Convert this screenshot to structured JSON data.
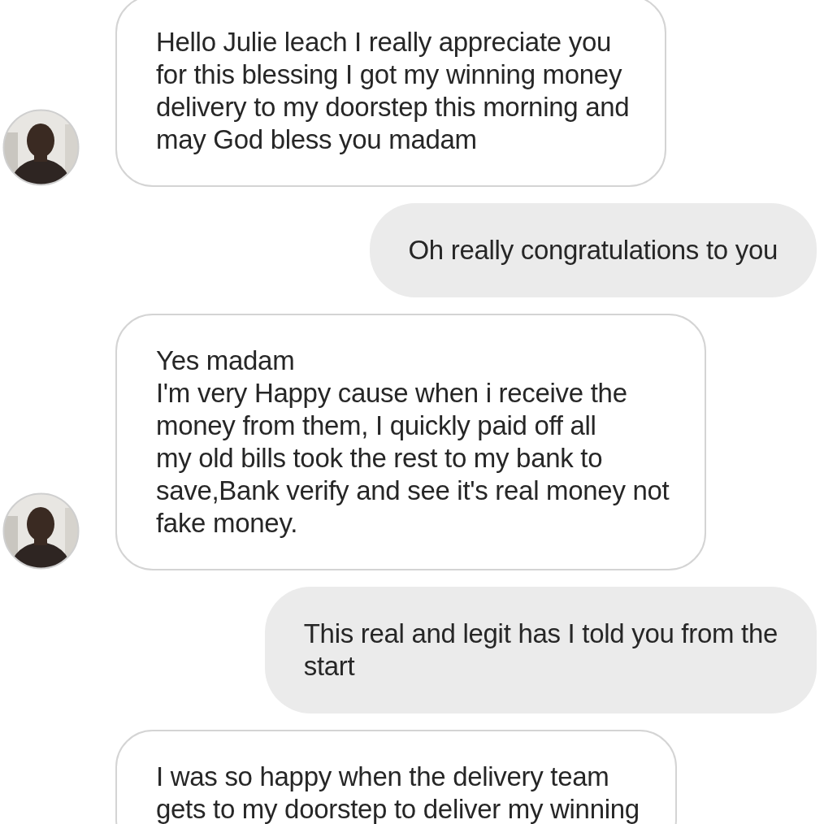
{
  "messages": [
    {
      "kind": "received",
      "text": "Hello Julie leach I really appreciate you\nfor this blessing I got my winning money\ndelivery to my doorstep this morning and\nmay God bless you madam",
      "avatar": true
    },
    {
      "kind": "sent",
      "text": "Oh really congratulations to you"
    },
    {
      "kind": "received",
      "text": "Yes madam\nI'm very Happy cause when i receive the\nmoney from them, I quickly paid off all\nmy old bills took the rest to my bank to\nsave,Bank verify and see it's real money not\nfake money.",
      "avatar": true
    },
    {
      "kind": "sent",
      "text": "This real and legit has I told you from the\nstart"
    },
    {
      "kind": "received",
      "text": "I was so happy when the delivery team\ngets to my doorstep to deliver my winning",
      "avatar": false
    }
  ]
}
